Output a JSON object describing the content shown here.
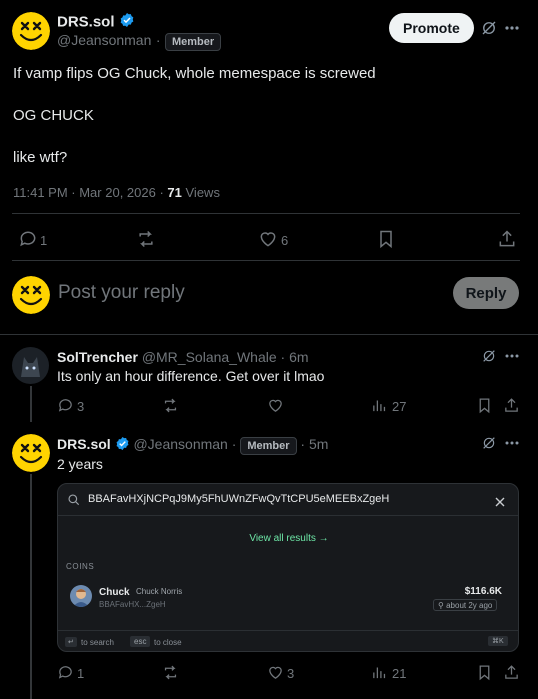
{
  "post": {
    "author_name": "DRS.sol",
    "author_handle": "@Jeansonman",
    "badge": "Member",
    "promote_label": "Promote",
    "lines": [
      "If vamp flips OG Chuck, whole memespace is screwed",
      "OG CHUCK",
      "like wtf?"
    ],
    "timestamp": "11:41 PM · Mar 20, 2026 ·",
    "views_count": "71",
    "views_label": "Views",
    "stats": {
      "replies": "1",
      "likes": "6"
    }
  },
  "composer": {
    "placeholder": "Post your reply",
    "reply_label": "Reply"
  },
  "replies": [
    {
      "name": "SolTrencher",
      "handle": "@MR_Solana_Whale",
      "time": "· 6m",
      "text": "Its only an hour difference.  Get over it lmao",
      "stats": {
        "replies": "3",
        "reposts": "",
        "likes": "",
        "views": "27"
      }
    },
    {
      "name": "DRS.sol",
      "handle": "@Jeansonman",
      "badge": "Member",
      "time": "· 5m",
      "text": "2 years",
      "stats": {
        "replies": "1",
        "reposts": "",
        "likes": "3",
        "views": "21"
      }
    }
  ],
  "search_popup": {
    "query": "BBAFavHXjNCPqJ9My5FhUWnZFwQvTtCPU5eMEEBxZgeH",
    "view_all": "View all results →",
    "section": "COINS",
    "coin": {
      "symbol": "Chuck",
      "name": "Chuck Norris",
      "address": "BBAFavHX...ZgeH",
      "price": "$116.6K",
      "age": "about 2y ago"
    },
    "footer": {
      "search_key": "↵",
      "search_label": "to search",
      "esc_key": "esc",
      "esc_label": "to close",
      "shortcut": "⌘K"
    }
  },
  "colors": {
    "accent_verified": "#1d9bf0",
    "avatar_yellow": "#ffd400",
    "view_all_green": "#6ee7a7"
  }
}
